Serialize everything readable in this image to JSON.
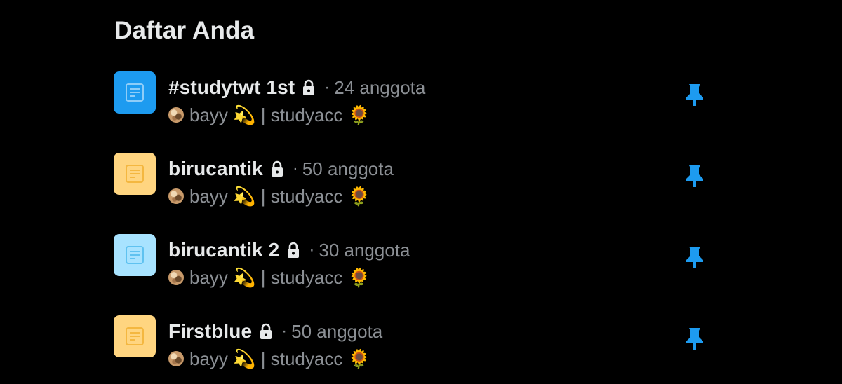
{
  "section": {
    "title": "Daftar Anda"
  },
  "lists": [
    {
      "name": "#studytwt 1st",
      "separator": "·",
      "member_count": "24 anggota",
      "owner": "bayy 💫 | studyacc 🌻",
      "thumb_color": "#1d9bf0",
      "thumb_icon_color": "#8ecdf8",
      "icons": {
        "lock": "lock-icon",
        "pin": "pin-icon",
        "thumb": "list-document-icon"
      }
    },
    {
      "name": "birucantik",
      "separator": "·",
      "member_count": "50 anggota",
      "owner": "bayy 💫 | studyacc 🌻",
      "thumb_color": "#ffd580",
      "thumb_icon_color": "#f4b740",
      "icons": {
        "lock": "lock-icon",
        "pin": "pin-icon",
        "thumb": "list-document-icon"
      }
    },
    {
      "name": "birucantik 2",
      "separator": "·",
      "member_count": "30 anggota",
      "owner": "bayy 💫 | studyacc 🌻",
      "thumb_color": "#a8e3ff",
      "thumb_icon_color": "#5fc2f0",
      "icons": {
        "lock": "lock-icon",
        "pin": "pin-icon",
        "thumb": "list-document-icon"
      }
    },
    {
      "name": "Firstblue",
      "separator": "·",
      "member_count": "50 anggota",
      "owner": "bayy 💫 | studyacc 🌻",
      "thumb_color": "#ffd580",
      "thumb_icon_color": "#f4b740",
      "icons": {
        "lock": "lock-icon",
        "pin": "pin-icon",
        "thumb": "list-document-icon"
      }
    }
  ],
  "colors": {
    "background": "#000000",
    "primary_text": "#e7e9ea",
    "secondary_text": "#8b8f94",
    "pin_accent": "#1d9bf0"
  }
}
